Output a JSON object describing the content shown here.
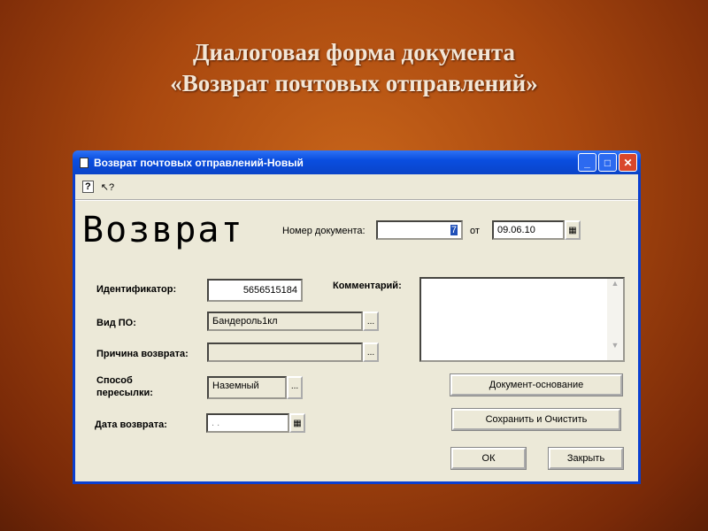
{
  "slide": {
    "title_line1": "Диалоговая форма документа",
    "title_line2": "«Возврат почтовых отправлений»"
  },
  "window": {
    "title": "Возврат почтовых отправлений-Новый",
    "minimize": "_",
    "maximize": "□",
    "close": "✕"
  },
  "toolbar": {
    "help": "?",
    "whats_this": "↖?"
  },
  "form": {
    "heading": "Возврат",
    "doc_number_label": "Номер документа:",
    "doc_number_value": "7",
    "date_from_label": "от",
    "date_from_value": "09.06.10",
    "identifier_label": "Идентификатор:",
    "identifier_value": "5656515184",
    "comment_label": "Комментарий:",
    "comment_value": "",
    "po_type_label": "Вид ПО:",
    "po_type_value": "Бандероль1кл",
    "reason_label": "Причина возврата:",
    "reason_value": "",
    "shipping_label_1": "Способ",
    "shipping_label_2": "пересылки:",
    "shipping_value": "Наземный",
    "return_date_label": "Дата возврата:",
    "return_date_value": " . .",
    "ellipsis": "...",
    "base_doc_button": "Документ-основание",
    "save_clear_button": "Сохранить и Очистить",
    "ok_button": "ОК",
    "close_button": "Закрыть"
  }
}
